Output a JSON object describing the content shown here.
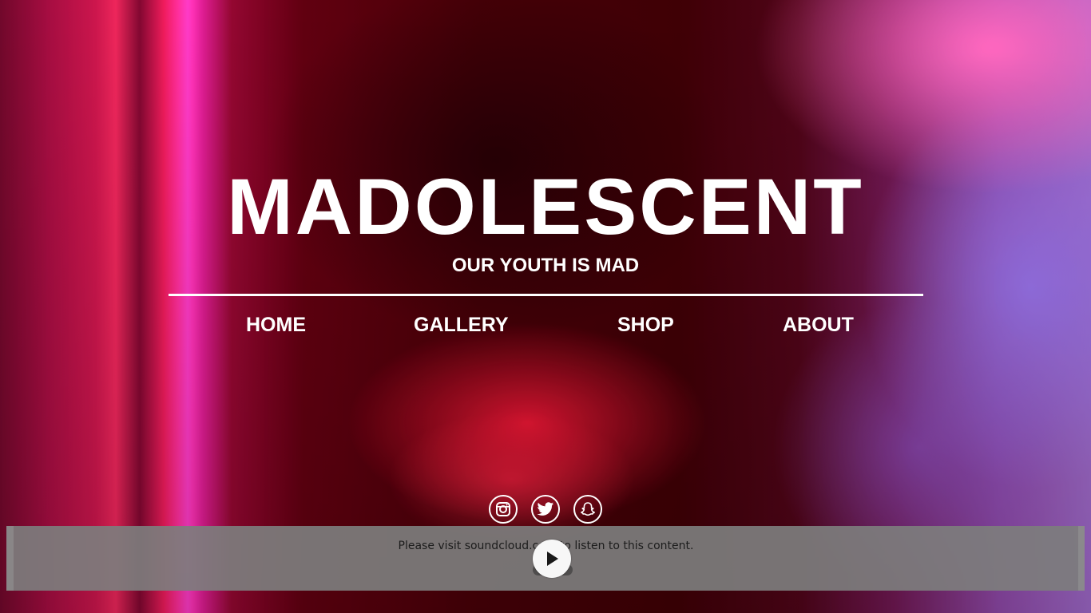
{
  "site": {
    "title": "MADOLESCENT",
    "tagline": "OUR YOUTH IS MAD"
  },
  "nav": {
    "items": [
      {
        "label": "HOME"
      },
      {
        "label": "GALLERY"
      },
      {
        "label": "SHOP"
      },
      {
        "label": "ABOUT"
      }
    ]
  },
  "social": {
    "icons": [
      "instagram-icon",
      "twitter-icon",
      "snapchat-icon"
    ]
  },
  "player": {
    "message": "Please visit soundcloud.com to listen to this content.",
    "play_icon": "play-icon"
  },
  "colors": {
    "text": "#ffffff",
    "player_bg": "#7d7d7d"
  }
}
